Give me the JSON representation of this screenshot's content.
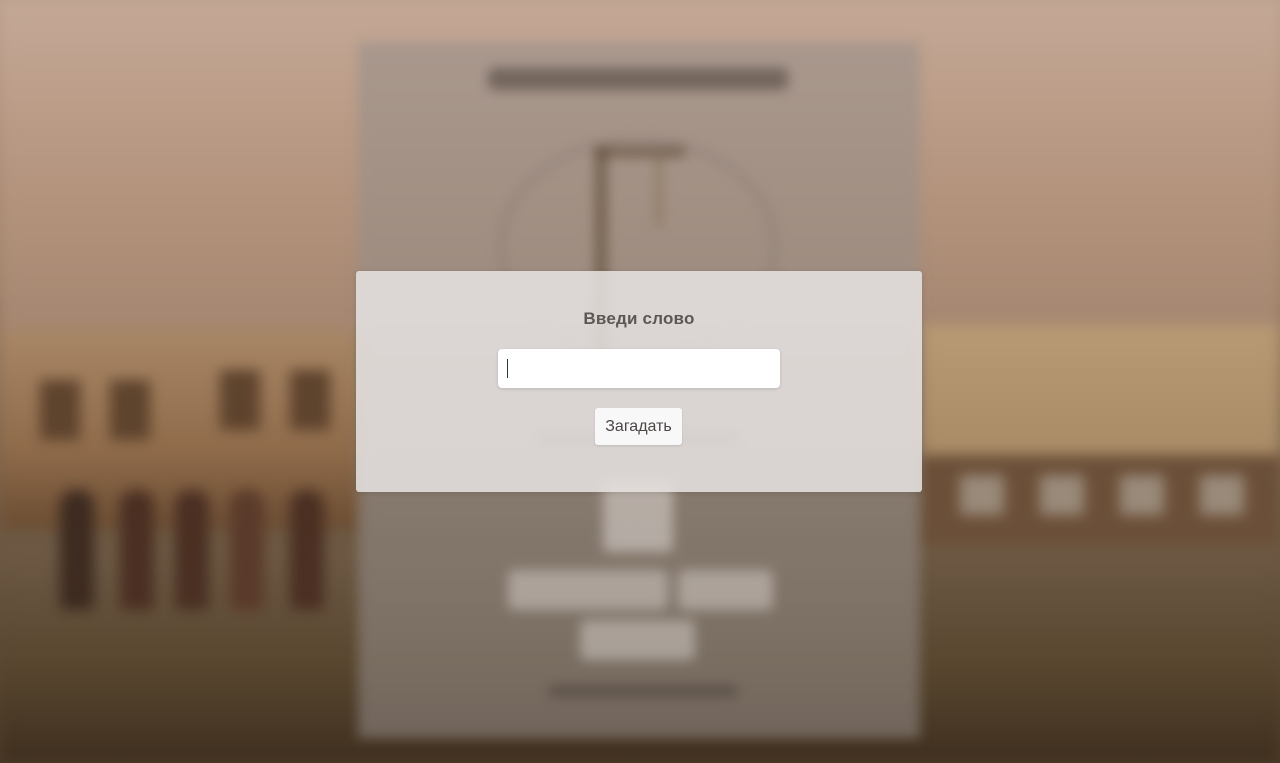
{
  "modal": {
    "title": "Введи слово",
    "input": {
      "value": "",
      "placeholder": ""
    },
    "submit_label": "Загадать"
  },
  "background": {
    "state": "blurred"
  }
}
